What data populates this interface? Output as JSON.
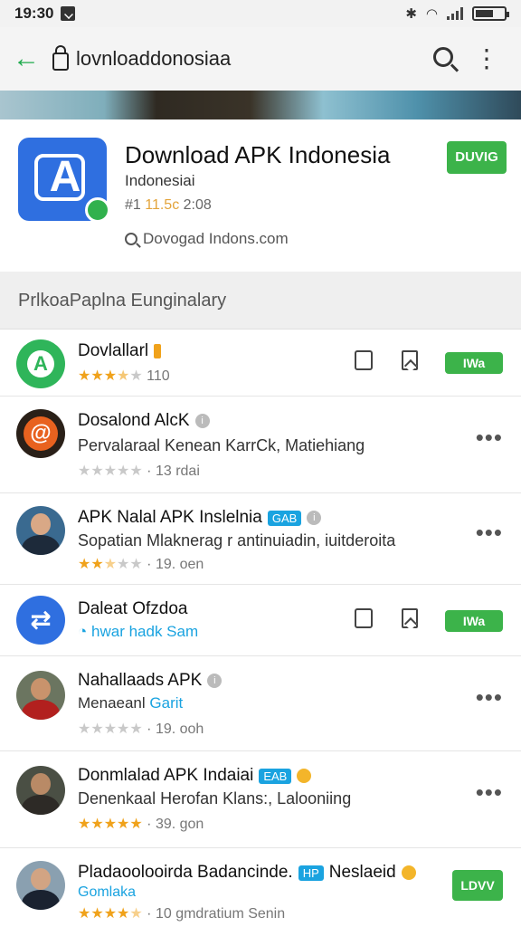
{
  "status_bar": {
    "time": "19:30"
  },
  "app_bar": {
    "url": "lovnloaddonosiaa"
  },
  "hero": {
    "title": "Download APK Indonesia",
    "subtitle": "Indonesiai",
    "meta_prefix": "#1",
    "meta_highlight": "11.5c",
    "meta_suffix": "2:08",
    "link": "Dovogad Indons.com",
    "button": "DUVIG"
  },
  "section": {
    "heading": "PrlkoaPaplna Eunginalary"
  },
  "list": [
    {
      "title": "Dovlallarl",
      "desc": "",
      "rating": "110",
      "stars": 3.5,
      "button": "IWa"
    },
    {
      "title": "Dosalond AlcK",
      "desc": "Pervalaraal Kenean KarrCk, Matiehiang",
      "rating": "· 13  rdai",
      "stars": 0
    },
    {
      "title": "APK Nalal APK Inslelnia",
      "tag": "GAB",
      "desc": "Sopatian Mlaknerag r antinuiadin, iuitderoita",
      "rating": "· 19. oen",
      "stars": 2.5
    },
    {
      "title": "Daleat Ofzdoa",
      "desc": "hwar hadk Sam",
      "button": "IWa"
    },
    {
      "title": "Nahallaads APK",
      "desc": "Menaeanl",
      "desc_highlight": "Garit",
      "rating": "· 19. ooh",
      "stars": 0
    },
    {
      "title": "Donmlalad APK Indaiai",
      "tag": "EAB",
      "desc": "Denenkaal Herofan Klans:, Lalooniing",
      "rating": "· 39. gon",
      "stars": 5
    },
    {
      "title": "Pladaoolooirda Badancinde.",
      "tag": "HP",
      "title_suffix": "Neslaeid",
      "desc": "Gomlaka",
      "rating": "· 10  gmdratium Senin",
      "stars": 4.5,
      "button": "LDVV"
    }
  ],
  "colors": {
    "accent": "#3cb34a",
    "star": "#f0a21b",
    "link": "#1aa3e0"
  }
}
